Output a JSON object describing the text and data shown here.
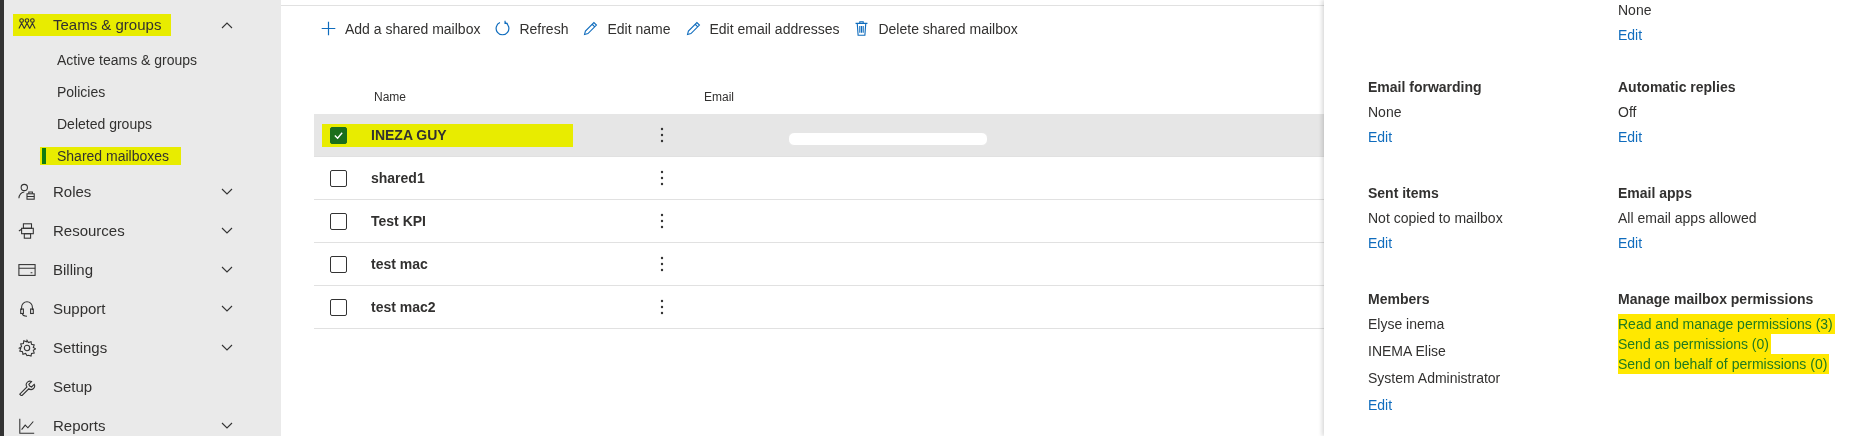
{
  "nav": [
    {
      "label": "Teams & groups",
      "expandable": true,
      "expanded": true,
      "highlighted": true,
      "children": [
        {
          "label": "Active teams & groups",
          "selected": false,
          "highlighted": false
        },
        {
          "label": "Policies",
          "selected": false,
          "highlighted": false
        },
        {
          "label": "Deleted groups",
          "selected": false,
          "highlighted": false
        },
        {
          "label": "Shared mailboxes",
          "selected": true,
          "highlighted": true
        }
      ]
    },
    {
      "label": "Roles",
      "expandable": true,
      "expanded": false,
      "highlighted": false
    },
    {
      "label": "Resources",
      "expandable": true,
      "expanded": false,
      "highlighted": false
    },
    {
      "label": "Billing",
      "expandable": true,
      "expanded": false,
      "highlighted": false
    },
    {
      "label": "Support",
      "expandable": true,
      "expanded": false,
      "highlighted": false
    },
    {
      "label": "Settings",
      "expandable": true,
      "expanded": false,
      "highlighted": false
    },
    {
      "label": "Setup",
      "expandable": false,
      "highlighted": false
    },
    {
      "label": "Reports",
      "expandable": true,
      "expanded": false,
      "highlighted": false
    }
  ],
  "toolbar": [
    {
      "label": "Add a shared mailbox"
    },
    {
      "label": "Refresh"
    },
    {
      "label": "Edit name"
    },
    {
      "label": "Edit email addresses"
    },
    {
      "label": "Delete shared mailbox"
    }
  ],
  "table": {
    "columns": [
      "Name",
      "Email"
    ],
    "rows": [
      {
        "name": "INEZA GUY",
        "selected": true,
        "highlighted": true,
        "email_redacted": true
      },
      {
        "name": "shared1",
        "selected": false,
        "highlighted": false,
        "email_redacted": false
      },
      {
        "name": "Test KPI",
        "selected": false,
        "highlighted": false,
        "email_redacted": false
      },
      {
        "name": "test mac",
        "selected": false,
        "highlighted": false,
        "email_redacted": false
      },
      {
        "name": "test mac2",
        "selected": false,
        "highlighted": false,
        "email_redacted": false
      }
    ]
  },
  "panel": {
    "top": {
      "value": "None",
      "link": "Edit"
    },
    "sections": [
      {
        "title": "Email forwarding",
        "kind": "text",
        "lines": [
          "None"
        ],
        "link": "Edit"
      },
      {
        "title": "Automatic replies",
        "kind": "text",
        "lines": [
          "Off"
        ],
        "link": "Edit"
      },
      {
        "title": "Sent items",
        "kind": "text",
        "lines": [
          "Not copied to mailbox"
        ],
        "link": "Edit"
      },
      {
        "title": "Email apps",
        "kind": "text",
        "lines": [
          "All email apps allowed"
        ],
        "link": "Edit"
      },
      {
        "title": "Members",
        "kind": "text",
        "lines": [
          "Elyse inema",
          "INEMA Elise",
          "System Administrator"
        ],
        "link": "Edit"
      },
      {
        "title": "Manage mailbox permissions",
        "kind": "links",
        "links": [
          {
            "label": "Read and manage permissions (3)",
            "highlighted": true
          },
          {
            "label": "Send as permissions (0)",
            "highlighted": true
          },
          {
            "label": "Send on behalf of permissions (0)",
            "highlighted": true
          }
        ]
      }
    ]
  }
}
